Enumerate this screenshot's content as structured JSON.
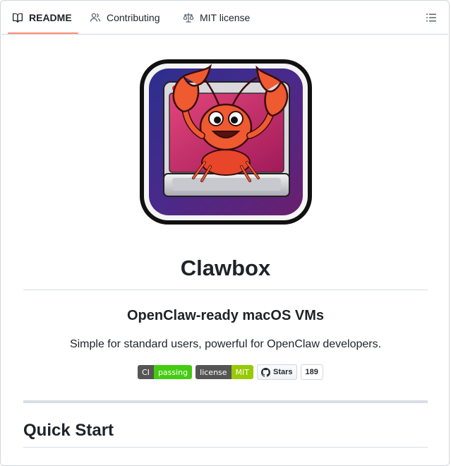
{
  "tabs": [
    {
      "label": "README",
      "icon": "book-icon",
      "active": true
    },
    {
      "label": "Contributing",
      "icon": "people-icon",
      "active": false
    },
    {
      "label": "MIT license",
      "icon": "law-icon",
      "active": false
    }
  ],
  "toc_icon": "list-unordered-icon",
  "accent_color": "#fd8c73",
  "logo": {
    "icon": "lobster-mac-logo"
  },
  "title": "Clawbox",
  "subtitle": "OpenClaw-ready macOS VMs",
  "description": "Simple for standard users, powerful for OpenClaw developers.",
  "badges": {
    "ci": {
      "label": "CI",
      "value": "passing",
      "color": "#44cc11"
    },
    "license": {
      "label": "license",
      "value": "MIT",
      "color": "#97ca00"
    },
    "stars": {
      "label": "Stars",
      "count": "189"
    }
  },
  "section_heading": "Quick Start"
}
